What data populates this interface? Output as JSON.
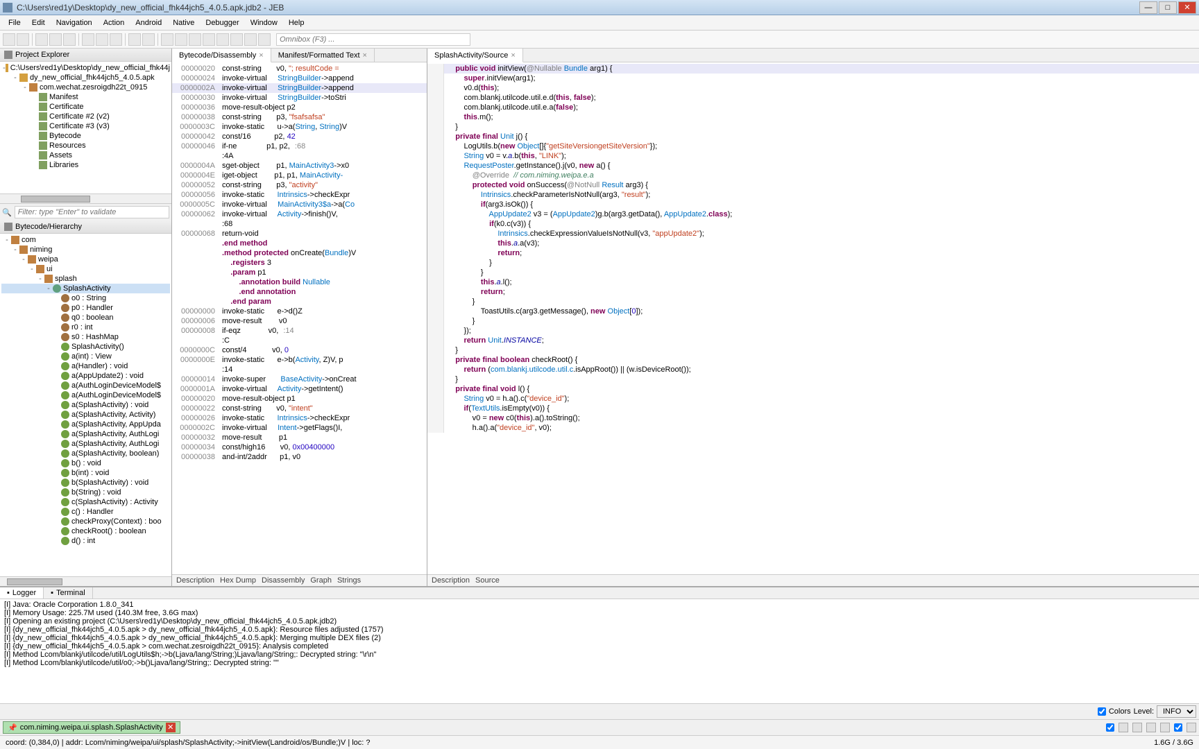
{
  "title": "C:\\Users\\red1y\\Desktop\\dy_new_official_fhk44jch5_4.0.5.apk.jdb2 - JEB",
  "menu": [
    "File",
    "Edit",
    "Navigation",
    "Action",
    "Android",
    "Native",
    "Debugger",
    "Window",
    "Help"
  ],
  "omnibox_placeholder": "Omnibox (F3) ...",
  "project_explorer": {
    "title": "Project Explorer",
    "root": "C:\\Users\\red1y\\Desktop\\dy_new_official_fhk44j",
    "items": [
      {
        "indent": 1,
        "toggle": "-",
        "icon": "ico-proj",
        "label": "dy_new_official_fhk44jch5_4.0.5.apk"
      },
      {
        "indent": 2,
        "toggle": "-",
        "icon": "ico-pkg",
        "label": "com.wechat.zesroigdh22t_0915"
      },
      {
        "indent": 3,
        "toggle": "",
        "icon": "ico-node",
        "label": "Manifest"
      },
      {
        "indent": 3,
        "toggle": "",
        "icon": "ico-node",
        "label": "Certificate"
      },
      {
        "indent": 3,
        "toggle": "",
        "icon": "ico-node",
        "label": "Certificate #2 (v2)"
      },
      {
        "indent": 3,
        "toggle": "",
        "icon": "ico-node",
        "label": "Certificate #3 (v3)"
      },
      {
        "indent": 3,
        "toggle": "",
        "icon": "ico-node",
        "label": "Bytecode"
      },
      {
        "indent": 3,
        "toggle": "",
        "icon": "ico-node",
        "label": "Resources"
      },
      {
        "indent": 3,
        "toggle": "",
        "icon": "ico-node",
        "label": "Assets"
      },
      {
        "indent": 3,
        "toggle": "",
        "icon": "ico-node",
        "label": "Libraries"
      }
    ],
    "filter_placeholder": "Filter: type \"Enter\" to validate"
  },
  "hierarchy": {
    "title": "Bytecode/Hierarchy",
    "items": [
      {
        "indent": 0,
        "toggle": "-",
        "icon": "ico-pkg",
        "label": "com"
      },
      {
        "indent": 1,
        "toggle": "-",
        "icon": "ico-pkg",
        "label": "niming"
      },
      {
        "indent": 2,
        "toggle": "-",
        "icon": "ico-pkg",
        "label": "weipa"
      },
      {
        "indent": 3,
        "toggle": "-",
        "icon": "ico-pkg",
        "label": "ui"
      },
      {
        "indent": 4,
        "toggle": "-",
        "icon": "ico-pkg",
        "label": "splash"
      },
      {
        "indent": 5,
        "toggle": "-",
        "icon": "ico-class",
        "label": "SplashActivity",
        "selected": true
      },
      {
        "indent": 6,
        "toggle": "",
        "icon": "ico-field",
        "label": "o0 : String"
      },
      {
        "indent": 6,
        "toggle": "",
        "icon": "ico-field",
        "label": "p0 : Handler"
      },
      {
        "indent": 6,
        "toggle": "",
        "icon": "ico-field",
        "label": "q0 : boolean"
      },
      {
        "indent": 6,
        "toggle": "",
        "icon": "ico-field",
        "label": "r0 : int"
      },
      {
        "indent": 6,
        "toggle": "",
        "icon": "ico-field",
        "label": "s0 : HashMap"
      },
      {
        "indent": 6,
        "toggle": "",
        "icon": "ico-method",
        "label": "SplashActivity()"
      },
      {
        "indent": 6,
        "toggle": "",
        "icon": "ico-method",
        "label": "a(int) : View"
      },
      {
        "indent": 6,
        "toggle": "",
        "icon": "ico-method",
        "label": "a(Handler) : void"
      },
      {
        "indent": 6,
        "toggle": "",
        "icon": "ico-method",
        "label": "a(AppUpdate2) : void"
      },
      {
        "indent": 6,
        "toggle": "",
        "icon": "ico-method",
        "label": "a(AuthLoginDeviceModel$"
      },
      {
        "indent": 6,
        "toggle": "",
        "icon": "ico-method",
        "label": "a(AuthLoginDeviceModel$"
      },
      {
        "indent": 6,
        "toggle": "",
        "icon": "ico-method",
        "label": "a(SplashActivity) : void"
      },
      {
        "indent": 6,
        "toggle": "",
        "icon": "ico-method",
        "label": "a(SplashActivity, Activity)"
      },
      {
        "indent": 6,
        "toggle": "",
        "icon": "ico-method",
        "label": "a(SplashActivity, AppUpda"
      },
      {
        "indent": 6,
        "toggle": "",
        "icon": "ico-method",
        "label": "a(SplashActivity, AuthLogi"
      },
      {
        "indent": 6,
        "toggle": "",
        "icon": "ico-method",
        "label": "a(SplashActivity, AuthLogi"
      },
      {
        "indent": 6,
        "toggle": "",
        "icon": "ico-method",
        "label": "a(SplashActivity, boolean)"
      },
      {
        "indent": 6,
        "toggle": "",
        "icon": "ico-method",
        "label": "b() : void"
      },
      {
        "indent": 6,
        "toggle": "",
        "icon": "ico-method",
        "label": "b(int) : void"
      },
      {
        "indent": 6,
        "toggle": "",
        "icon": "ico-method",
        "label": "b(SplashActivity) : void"
      },
      {
        "indent": 6,
        "toggle": "",
        "icon": "ico-method",
        "label": "b(String) : void"
      },
      {
        "indent": 6,
        "toggle": "",
        "icon": "ico-method",
        "label": "c(SplashActivity) : Activity"
      },
      {
        "indent": 6,
        "toggle": "",
        "icon": "ico-method",
        "label": "c() : Handler"
      },
      {
        "indent": 6,
        "toggle": "",
        "icon": "ico-method",
        "label": "checkProxy(Context) : boo"
      },
      {
        "indent": 6,
        "toggle": "",
        "icon": "ico-method",
        "label": "checkRoot() : boolean"
      },
      {
        "indent": 6,
        "toggle": "",
        "icon": "ico-method",
        "label": "d() : int"
      }
    ]
  },
  "center": {
    "tabs": [
      {
        "label": "Bytecode/Disassembly",
        "active": true,
        "closable": true
      },
      {
        "label": "Manifest/Formatted Text",
        "active": false,
        "closable": true
      }
    ],
    "lines": [
      {
        "addr": "00000020",
        "text": "const-string       v0, <s>\"; resultCode = </s>"
      },
      {
        "addr": "00000024",
        "text": "invoke-virtual     <t>StringBuilder</t>->append"
      },
      {
        "addr": "0000002A",
        "text": "invoke-virtual     <t>StringBuilder</t>->append",
        "hl": true
      },
      {
        "addr": "00000030",
        "text": "invoke-virtual     <t>StringBuilder</t>->toStri"
      },
      {
        "addr": "00000036",
        "text": "move-result-object p2"
      },
      {
        "addr": "00000038",
        "text": "const-string       p3, <s>\"fsafsafsa\"</s>"
      },
      {
        "addr": "0000003C",
        "text": "invoke-static      u->a(<t>String</t>, <t>String</t>)V"
      },
      {
        "addr": "00000042",
        "text": "const/16           p2, <n>42</n>"
      },
      {
        "addr": "00000046",
        "text": "if-ne              p1, p2, <o>:68</o>"
      },
      {
        "addr": "",
        "text": ":4A"
      },
      {
        "addr": "0000004A",
        "text": "sget-object        p1, <t>MainActivity3</t>->x0"
      },
      {
        "addr": "0000004E",
        "text": "iget-object        p1, p1, <t>MainActivity-</t>"
      },
      {
        "addr": "00000052",
        "text": "const-string       p3, <s>\"activity\"</s>"
      },
      {
        "addr": "00000056",
        "text": "invoke-static      <t>Intrinsics</t>->checkExpr"
      },
      {
        "addr": "0000005C",
        "text": "invoke-virtual     <t>MainActivity3$a</t>->a(<t>Co</t>"
      },
      {
        "addr": "00000062",
        "text": "invoke-virtual     <t>Activity</t>->finish()V,"
      },
      {
        "addr": "",
        "text": ":68"
      },
      {
        "addr": "00000068",
        "text": "return-void"
      },
      {
        "addr": "",
        "text": "<k>.end method</k>"
      },
      {
        "addr": "",
        "text": ""
      },
      {
        "addr": "",
        "text": "<k>.method protected</k> onCreate(<t>Bundle</t>)V"
      },
      {
        "addr": "",
        "text": "    <k>.registers</k> 3"
      },
      {
        "addr": "",
        "text": "    <k>.param</k> p1"
      },
      {
        "addr": "",
        "text": "        <k>.annotation build</k> <t>Nullable</t>"
      },
      {
        "addr": "",
        "text": "        <k>.end annotation</k>"
      },
      {
        "addr": "",
        "text": "    <k>.end param</k>"
      },
      {
        "addr": "00000000",
        "text": "invoke-static      e->d()Z"
      },
      {
        "addr": "00000006",
        "text": "move-result        v0"
      },
      {
        "addr": "00000008",
        "text": "if-eqz             v0, <o>:14</o>"
      },
      {
        "addr": "",
        "text": ":C"
      },
      {
        "addr": "0000000C",
        "text": "const/4            v0, <n>0</n>"
      },
      {
        "addr": "0000000E",
        "text": "invoke-static      e->b(<t>Activity</t>, Z)V, p"
      },
      {
        "addr": "",
        "text": ":14"
      },
      {
        "addr": "00000014",
        "text": "invoke-super       <t>BaseActivity</t>->onCreat"
      },
      {
        "addr": "0000001A",
        "text": "invoke-virtual     <t>Activity</t>->getIntent()"
      },
      {
        "addr": "00000020",
        "text": "move-result-object p1"
      },
      {
        "addr": "00000022",
        "text": "const-string       v0, <s>\"intent\"</s>"
      },
      {
        "addr": "00000026",
        "text": "invoke-static      <t>Intrinsics</t>->checkExpr"
      },
      {
        "addr": "0000002C",
        "text": "invoke-virtual     <t>Intent</t>->getFlags()I,"
      },
      {
        "addr": "00000032",
        "text": "move-result        p1"
      },
      {
        "addr": "00000034",
        "text": "const/high16       v0, <n>0x00400000</n>"
      },
      {
        "addr": "00000038",
        "text": "and-int/2addr      p1, v0"
      }
    ],
    "sub_tabs": [
      "Description",
      "Hex Dump",
      "Disassembly",
      "Graph",
      "Strings"
    ]
  },
  "right": {
    "tabs": [
      {
        "label": "SplashActivity/Source",
        "active": true,
        "closable": true
      }
    ],
    "source_lines": [
      "    <k>public void</k> initView(<a>@Nullable</a> <t>Bundle</t> arg1) {",
      "        <k>super</k>.initView(arg1);",
      "        v0.d(<k>this</k>);",
      "        com.blankj.utilcode.util.e.d(<k>this</k>, <k>false</k>);",
      "        com.blankj.utilcode.util.e.a(<k>false</k>);",
      "        <k>this</k>.m();",
      "    }",
      "",
      "    <k>private final</k> <t>Unit</t> j() {",
      "        LogUtils.b(<k>new</k> <t>Object</t>[]{<s>\"getSiteVersiongetSiteVersion\"</s>});",
      "        <t>String</t> v0 = v.<f>a</f>.b(<k>this</k>, <s>\"LINK\"</s>);",
      "        <t>RequestPoster</t>.getInstance().j(v0, <k>new</k> a() {",
      "            <a>@Override</a>  <c>// com.niming.weipa.e.a</c>",
      "            <k>protected void</k> onSuccess(<a>@NotNull</a> <t>Result</t> arg3) {",
      "                <t>Intrinsics</t>.checkParameterIsNotNull(arg3, <s>\"result\"</s>);",
      "                <k>if</k>(arg3.isOk()) {",
      "                    <t>AppUpdate2</t> v3 = (<t>AppUpdate2</t>)g.b(arg3.getData(), <t>AppUpdate2</t>.<k>class</k>);",
      "                    <k>if</k>(k0.c(v3)) {",
      "                        <t>Intrinsics</t>.checkExpressionValueIsNotNull(v3, <s>\"appUpdate2\"</s>);",
      "                        <k>this</k>.<f>a</f>.a(v3);",
      "                        <k>return</k>;",
      "                    }",
      "                }",
      "",
      "                <k>this</k>.<f>a</f>.l();",
      "                <k>return</k>;",
      "            }",
      "",
      "                ToastUtils.c(arg3.getMessage(), <k>new</k> <t>Object</t>[<n>0</n>]);",
      "            }",
      "        });",
      "        <k>return</k> <t>Unit</t>.<f>INSTANCE</f>;",
      "    }",
      "",
      "    <k>private final boolean</k> checkRoot() {",
      "        <k>return</k> (<t>com.blankj.utilcode.util.c</t>.isAppRoot()) || (w.isDeviceRoot());",
      "    }",
      "",
      "    <k>private final void</k> l() {",
      "        <t>String</t> v0 = h.a().c(<s>\"device_id\"</s>);",
      "        <k>if</k>(<t>TextUtils</t>.isEmpty(v0)) {",
      "            v0 = <k>new</k> c0(<k>this</k>).a().toString();",
      "            h.a().a(<s>\"device_id\"</s>, v0);"
    ],
    "highlight_line": 0,
    "sub_tabs": [
      "Description",
      "Source"
    ]
  },
  "logger": {
    "tabs": [
      {
        "label": "Logger",
        "active": true
      },
      {
        "label": "Terminal",
        "active": false
      }
    ],
    "lines": [
      "[I] Java: Oracle Corporation 1.8.0_341",
      "[I] Memory Usage: 225.7M used (140.3M free, 3.6G max)",
      "[I] Opening an existing project (C:\\Users\\red1y\\Desktop\\dy_new_official_fhk44jch5_4.0.5.apk.jdb2)",
      "[I] {dy_new_official_fhk44jch5_4.0.5.apk > dy_new_official_fhk44jch5_4.0.5.apk}: Resource files adjusted (1757)",
      "[I] {dy_new_official_fhk44jch5_4.0.5.apk > dy_new_official_fhk44jch5_4.0.5.apk}: Merging multiple DEX files (2)",
      "[I] {dy_new_official_fhk44jch5_4.0.5.apk > com.wechat.zesroigdh22t_0915}: Analysis completed",
      "[I] Method Lcom/blankj/utilcode/util/LogUtils$h;->b(Ljava/lang/String;)Ljava/lang/String;: Decrypted string: \"\\r\\n\"",
      "[I] Method Lcom/blankj/utilcode/util/o0;->b()Ljava/lang/String;: Decrypted string: \"\""
    ],
    "colors_label": "Colors",
    "level_label": "Level:",
    "level_value": "INFO"
  },
  "task_chip": "com.niming.weipa.ui.splash.SplashActivity",
  "status_left": "coord: (0,384,0) | addr: Lcom/niming/weipa/ui/splash/SplashActivity;->initView(Landroid/os/Bundle;)V | loc: ?",
  "status_right": "1.6G / 3.6G"
}
